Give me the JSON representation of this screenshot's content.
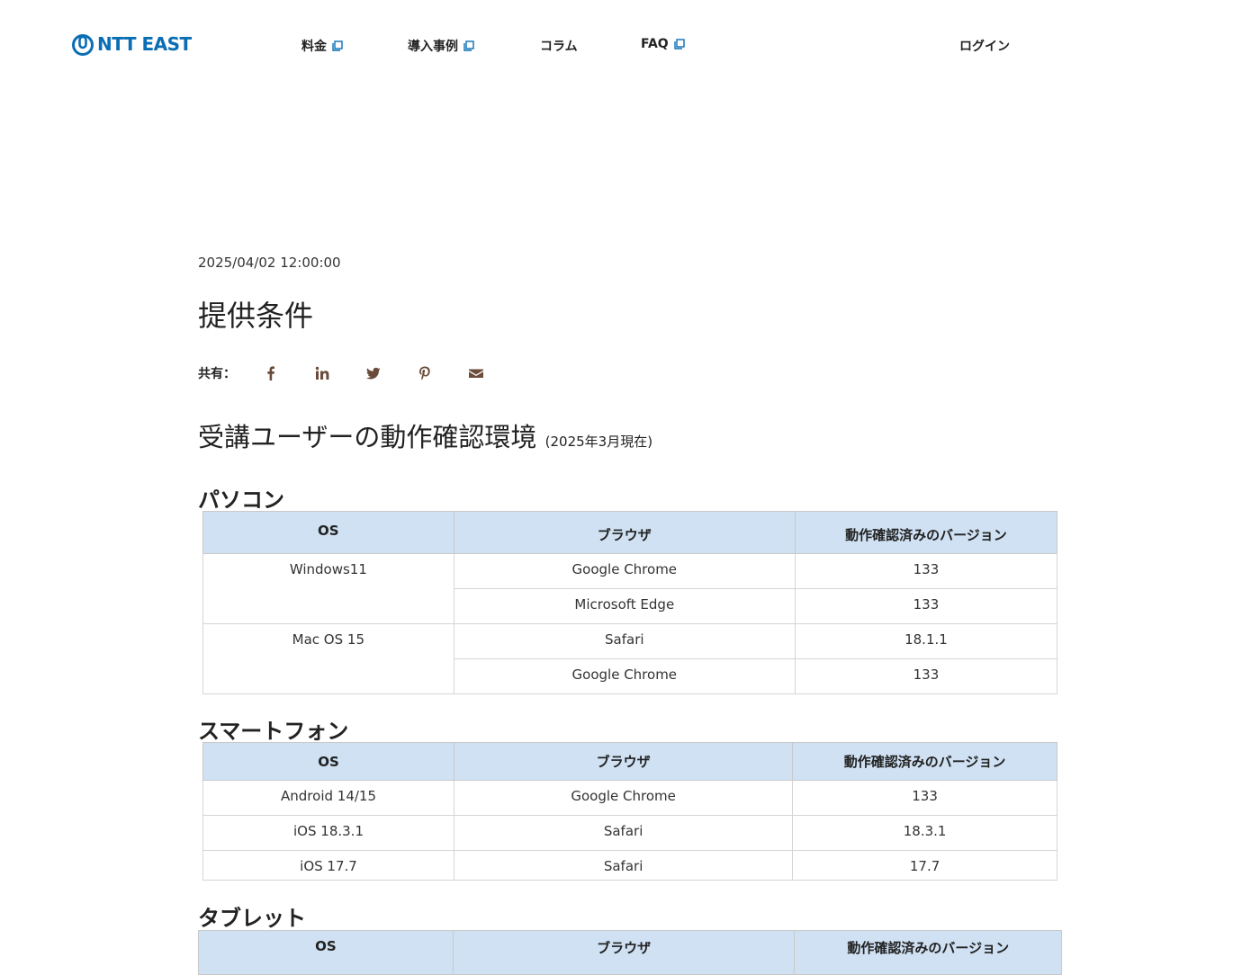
{
  "header": {
    "logo_text": "NTT EAST",
    "nav": [
      {
        "label": "料金",
        "external": true
      },
      {
        "label": "導入事例",
        "external": true
      },
      {
        "label": "コラム",
        "external": false
      },
      {
        "label": "FAQ",
        "external": true
      }
    ],
    "login_label": "ログイン"
  },
  "article": {
    "timestamp": "2025/04/02 12:00:00",
    "title": "提供条件",
    "share_label": "共有：",
    "share_icons": [
      "facebook-icon",
      "linkedin-icon",
      "twitter-icon",
      "pinterest-icon",
      "email-icon"
    ],
    "section_title": "受講ユーザーの動作確認環境",
    "section_note": "(2025年3月現在)"
  },
  "tables": {
    "headers": [
      "OS",
      "ブラウザ",
      "動作確認済みのバージョン"
    ],
    "pc": {
      "title": "パソコン",
      "rows": [
        {
          "os": "Windows11",
          "browser": "Google Chrome",
          "version": "133"
        },
        {
          "os": "",
          "browser": "Microsoft Edge",
          "version": "133"
        },
        {
          "os": "Mac OS 15",
          "browser": "Safari",
          "version": "18.1.1"
        },
        {
          "os": "",
          "browser": "Google Chrome",
          "version": "133"
        }
      ]
    },
    "smartphone": {
      "title": "スマートフォン",
      "rows": [
        {
          "os": "Android 14/15",
          "browser": "Google Chrome",
          "version": "133"
        },
        {
          "os": "iOS 18.3.1",
          "browser": "Safari",
          "version": "18.3.1"
        },
        {
          "os": "iOS 17.7",
          "browser": "Safari",
          "version": "17.7"
        }
      ]
    },
    "tablet": {
      "title": "タブレット"
    }
  },
  "colors": {
    "brand": "#0a6eb4",
    "table_header_bg": "#cfe1f3",
    "share_icon": "#6b4c3b"
  }
}
